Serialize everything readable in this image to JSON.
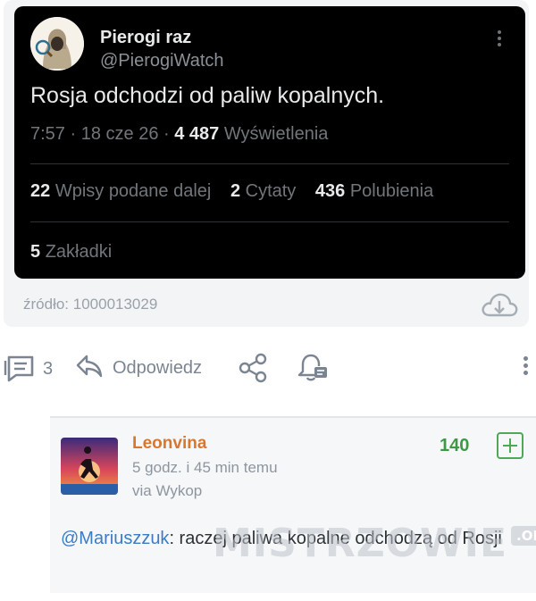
{
  "tweet": {
    "author_name": "Pierogi raz",
    "author_handle": "@PierogiWatch",
    "text": "Rosja odchodzi od paliw kopalnych.",
    "time": "7:57",
    "date": "18 cze 26",
    "views_count": "4 487",
    "views_label": "Wyświetlenia",
    "reposts_count": "22",
    "reposts_label": "Wpisy podane dalej",
    "quotes_count": "2",
    "quotes_label": "Cytaty",
    "likes_count": "436",
    "likes_label": "Polubienia",
    "bookmarks_count": "5",
    "bookmarks_label": "Zakładki"
  },
  "embed": {
    "source_label": "źródło: 1000013029"
  },
  "actions": {
    "comments_count": "3",
    "reply_label": "Odpowiedz"
  },
  "comment": {
    "author": "Leonvina",
    "time": "5 godz. i 45 min temu",
    "via": "via Wykop",
    "votes": "140",
    "mention": "@Mariuszzuk",
    "text": ": raczej paliwa kopalne odchodzą od Rosji"
  },
  "watermark": {
    "text": "MISTRZOWIE",
    "suffix": ".ORG"
  },
  "colors": {
    "tweet_bg": "#000000",
    "author_orange": "#d9772f",
    "votes_green": "#3d9a44",
    "mention_blue": "#3b7cc4",
    "icon_gray": "#7b8591"
  },
  "icons": [
    "avatar-hooded-figure-icon",
    "more-vertical-icon",
    "cloud-download-icon",
    "comments-icon",
    "reply-arrow-icon",
    "share-icon",
    "notification-bell-icon",
    "plus-icon"
  ]
}
